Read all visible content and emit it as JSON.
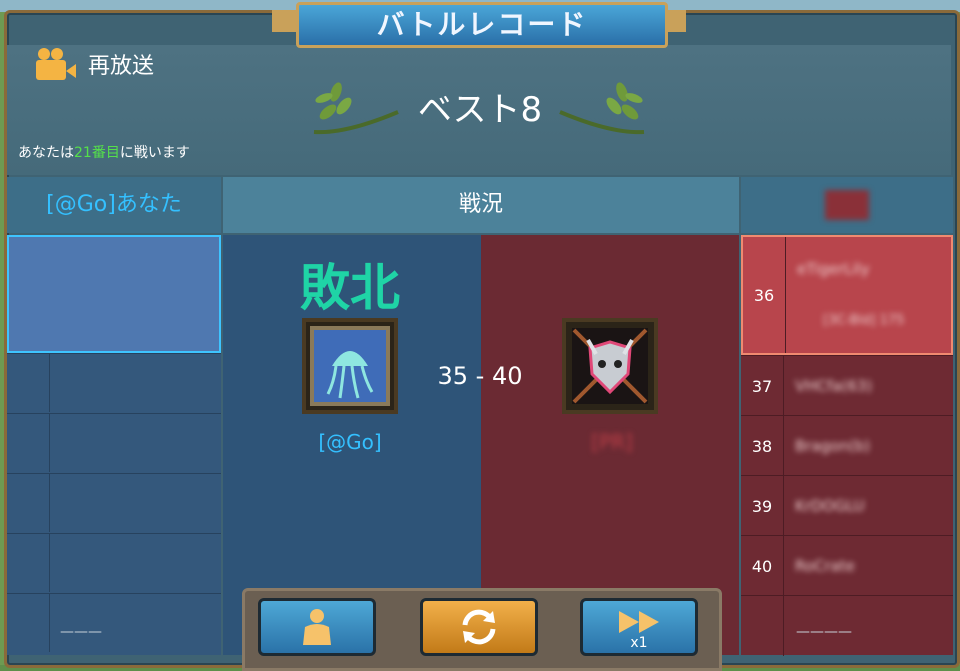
{
  "header": {
    "title": "バトルレコード"
  },
  "replay": {
    "label": "再放送"
  },
  "round": {
    "title": "ベスト8"
  },
  "info": {
    "prefix": "あなたは",
    "highlight": "21番目",
    "suffix": "に戦います"
  },
  "columns": {
    "left": "[@Go]あなた",
    "middle": "戦況",
    "right": ""
  },
  "match": {
    "result": "敗北",
    "score": "35 - 40",
    "ally_tag": "[@Go]",
    "enemy_tag": "[PR]"
  },
  "right_list": {
    "rows": [
      {
        "num": "36",
        "name": "eTigerLily",
        "sub": "[3C-Bld] 175"
      },
      {
        "num": "37",
        "name": "VHCfa(63)"
      },
      {
        "num": "38",
        "name": "Bragon(b)"
      },
      {
        "num": "39",
        "name": "KrDOGLU"
      },
      {
        "num": "40",
        "name": "RoCrate"
      }
    ]
  },
  "footer": {
    "left": "———",
    "right": "————"
  },
  "controls": {
    "speed_label": "x1",
    "icons": [
      "player-icon",
      "refresh-icon",
      "fast-forward-icon"
    ]
  },
  "colors": {
    "ally": "#34c0ff",
    "defeat": "#1fd4a6",
    "enemy": "#c04048",
    "gold": "#c9a15a"
  }
}
